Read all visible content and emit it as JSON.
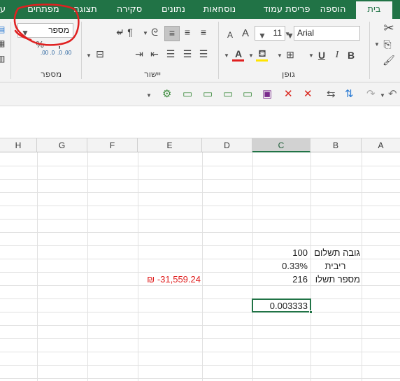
{
  "tabs": [
    {
      "label": "בית",
      "active": true
    },
    {
      "label": "הוספה"
    },
    {
      "label": "פריסת עמוד"
    },
    {
      "label": "נוסחאות"
    },
    {
      "label": "נתונים"
    },
    {
      "label": "סקירה"
    },
    {
      "label": "תצוגה"
    },
    {
      "label": "מפתחים"
    },
    {
      "label": "ע"
    }
  ],
  "ribbon": {
    "font_group_label": "גופן",
    "alignment_group_label": "יישור",
    "number_group_label": "מספר",
    "font_name": "Arial",
    "font_size": "11",
    "number_format": "מספר",
    "bold_label": "B",
    "italic_label": "I",
    "underline_label": "U",
    "font_color_label": "A",
    "grow_font_label": "A",
    "shrink_font_label": "A",
    "percent_label": "%",
    "comma_label": ",",
    "inc_decimal_label": ".0 .00",
    "dec_decimal_label": ".00 .0"
  },
  "accent_color": "#217346",
  "annotation_color": "#e02020",
  "columns": [
    "H",
    "G",
    "F",
    "E",
    "D",
    "C",
    "B",
    "A"
  ],
  "selected_column": "C",
  "cells": {
    "b_payment_height": "גובה תשלום",
    "c_payment_height": "100",
    "b_rate": "ריבית",
    "c_rate": "0.33%",
    "b_num_payments": "מספר תשלו",
    "c_num_payments": "216",
    "e_result": "₪ -31,559.24",
    "c_active": "0.003333"
  }
}
